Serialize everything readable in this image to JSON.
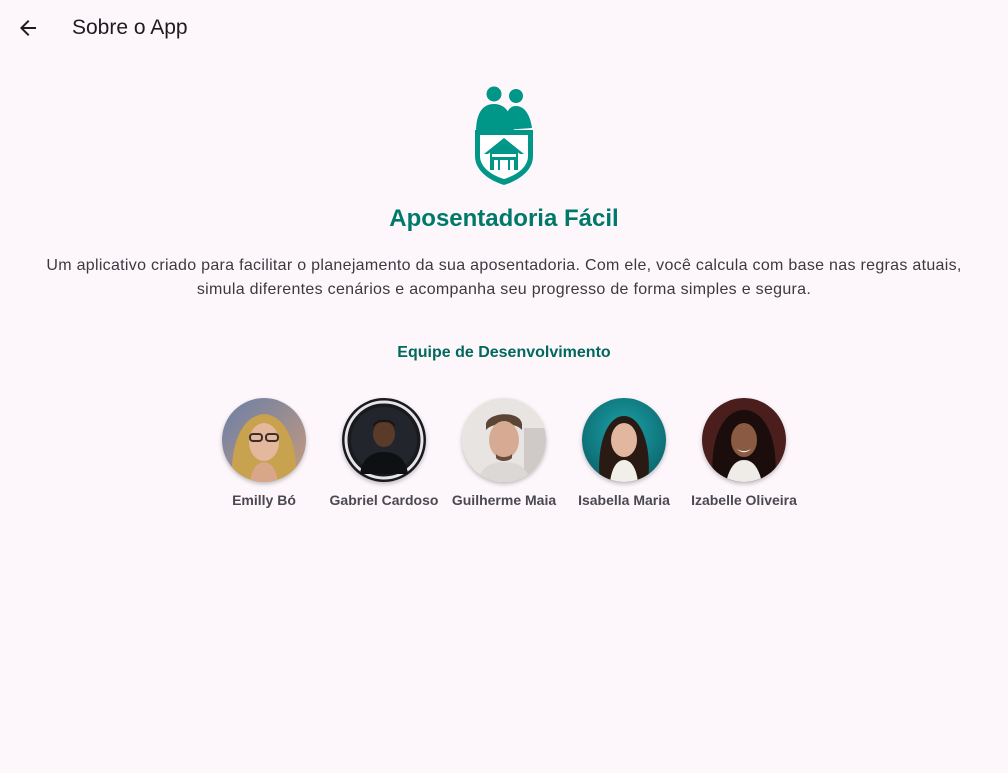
{
  "appbar": {
    "back_icon": "arrow-back-icon",
    "title": "Sobre o App"
  },
  "hero": {
    "logo_icon": "retirees-house-shield-icon",
    "app_name": "Aposentadoria Fácil",
    "description": "Um aplicativo criado para facilitar o planejamento da sua aposentadoria. Com ele, você calcula com base nas regras atuais, simula diferentes cenários e acompanha seu progresso de forma simples e segura."
  },
  "team": {
    "heading": "Equipe de Desenvolvimento",
    "members": [
      {
        "name": "Emilly Bó"
      },
      {
        "name": "Gabriel Cardoso"
      },
      {
        "name": "Guilherme Maia"
      },
      {
        "name": "Isabella Maria"
      },
      {
        "name": "Izabelle Oliveira"
      }
    ]
  },
  "colors": {
    "background": "#fdf7fc",
    "accent": "#00796b",
    "logo": "#009688"
  }
}
